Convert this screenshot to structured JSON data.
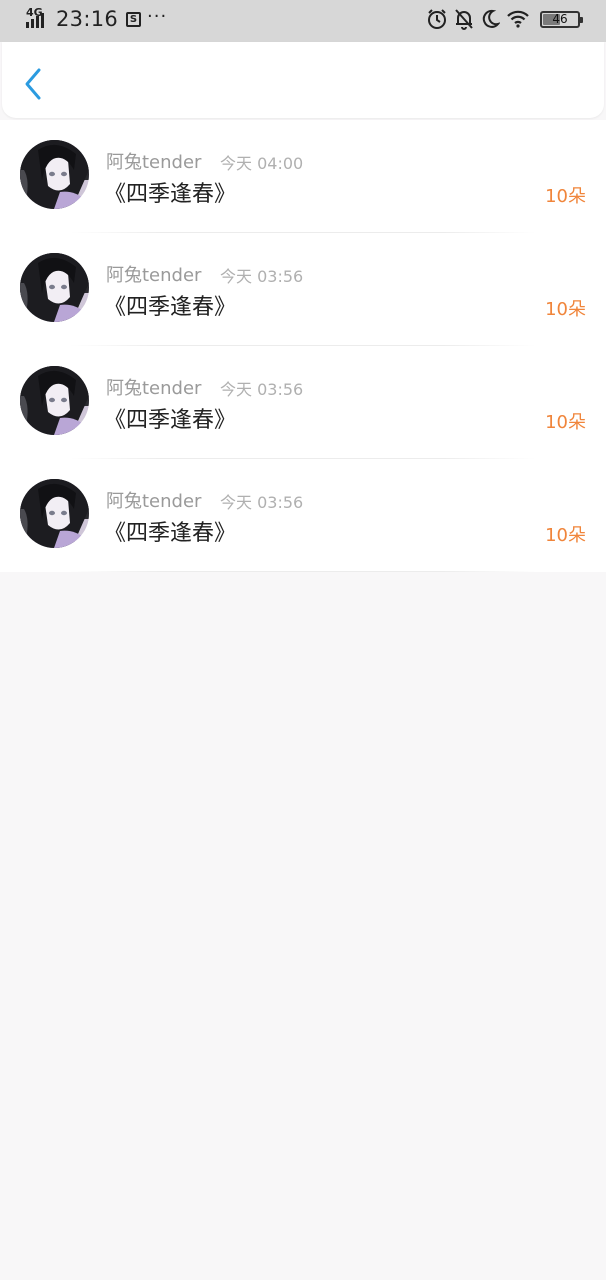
{
  "status_bar": {
    "network": "4G",
    "time": "23:16",
    "battery": "46",
    "battery_level": 0.46,
    "icons": [
      "signal-icon",
      "screenshot-icon",
      "more-dots-icon",
      "alarm-icon",
      "bell-off-icon",
      "moon-icon",
      "wifi-icon",
      "battery-icon"
    ]
  },
  "nav": {
    "back_icon": "chevron-left-icon",
    "accent": "#2b9be0"
  },
  "colors": {
    "count": "#f0853b",
    "name": "#9a9a9a",
    "time": "#b0b0b0",
    "title": "#222222"
  },
  "items": [
    {
      "name": "阿兔tender",
      "time": "今天 04:00",
      "title": "《四季逢春》",
      "count": "10朵"
    },
    {
      "name": "阿兔tender",
      "time": "今天 03:56",
      "title": "《四季逢春》",
      "count": "10朵"
    },
    {
      "name": "阿兔tender",
      "time": "今天 03:56",
      "title": "《四季逢春》",
      "count": "10朵"
    },
    {
      "name": "阿兔tender",
      "time": "今天 03:56",
      "title": "《四季逢春》",
      "count": "10朵"
    }
  ]
}
